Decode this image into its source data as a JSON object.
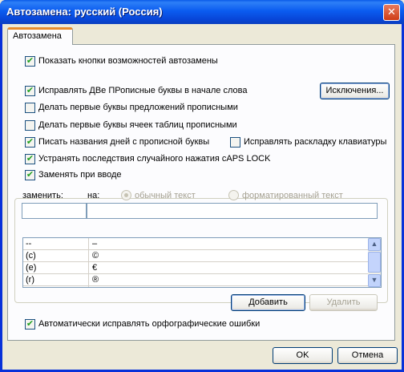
{
  "window": {
    "title": "Автозамена: русский (Россия)",
    "close_glyph": "✕"
  },
  "tabs": [
    {
      "label": "Автозамена",
      "active": true
    }
  ],
  "options": {
    "show_buttons": {
      "label": "Показать кнопки возможностей автозамены",
      "checked": true
    },
    "two_caps": {
      "label": "Исправлять ДВе ПРописные буквы в начале слова",
      "checked": true
    },
    "sentence_caps": {
      "label": "Делать первые буквы предложений прописными",
      "checked": false
    },
    "table_cell_caps": {
      "label": "Делать первые буквы ячеек таблиц прописными",
      "checked": false
    },
    "day_names": {
      "label": "Писать названия дней с прописной буквы",
      "checked": true
    },
    "keyboard_layout": {
      "label": "Исправлять раскладку клавиатуры",
      "checked": false
    },
    "caps_lock": {
      "label": "Устранять последствия случайного нажатия cAPS LOCK",
      "checked": true
    },
    "replace_as_type": {
      "label": "Заменять при вводе",
      "checked": true
    },
    "spelling": {
      "label": "Автоматически исправлять орфографические ошибки",
      "checked": true
    }
  },
  "buttons": {
    "exceptions": "Исключения...",
    "add": "Добавить",
    "delete": "Удалить",
    "ok": "OK",
    "cancel": "Отмена"
  },
  "replace": {
    "replace_label": "заменить:",
    "with_label": "на:",
    "plain_text": "обычный текст",
    "formatted_text": "форматированный текст",
    "replace_value": "",
    "with_value": ""
  },
  "entries": [
    {
      "from": "--",
      "to": "–"
    },
    {
      "from": "(c)",
      "to": "©"
    },
    {
      "from": "(e)",
      "to": "€"
    },
    {
      "from": "(r)",
      "to": "®"
    }
  ],
  "icons": {
    "check": "✔",
    "scroll_up": "▲",
    "scroll_down": "▼"
  }
}
